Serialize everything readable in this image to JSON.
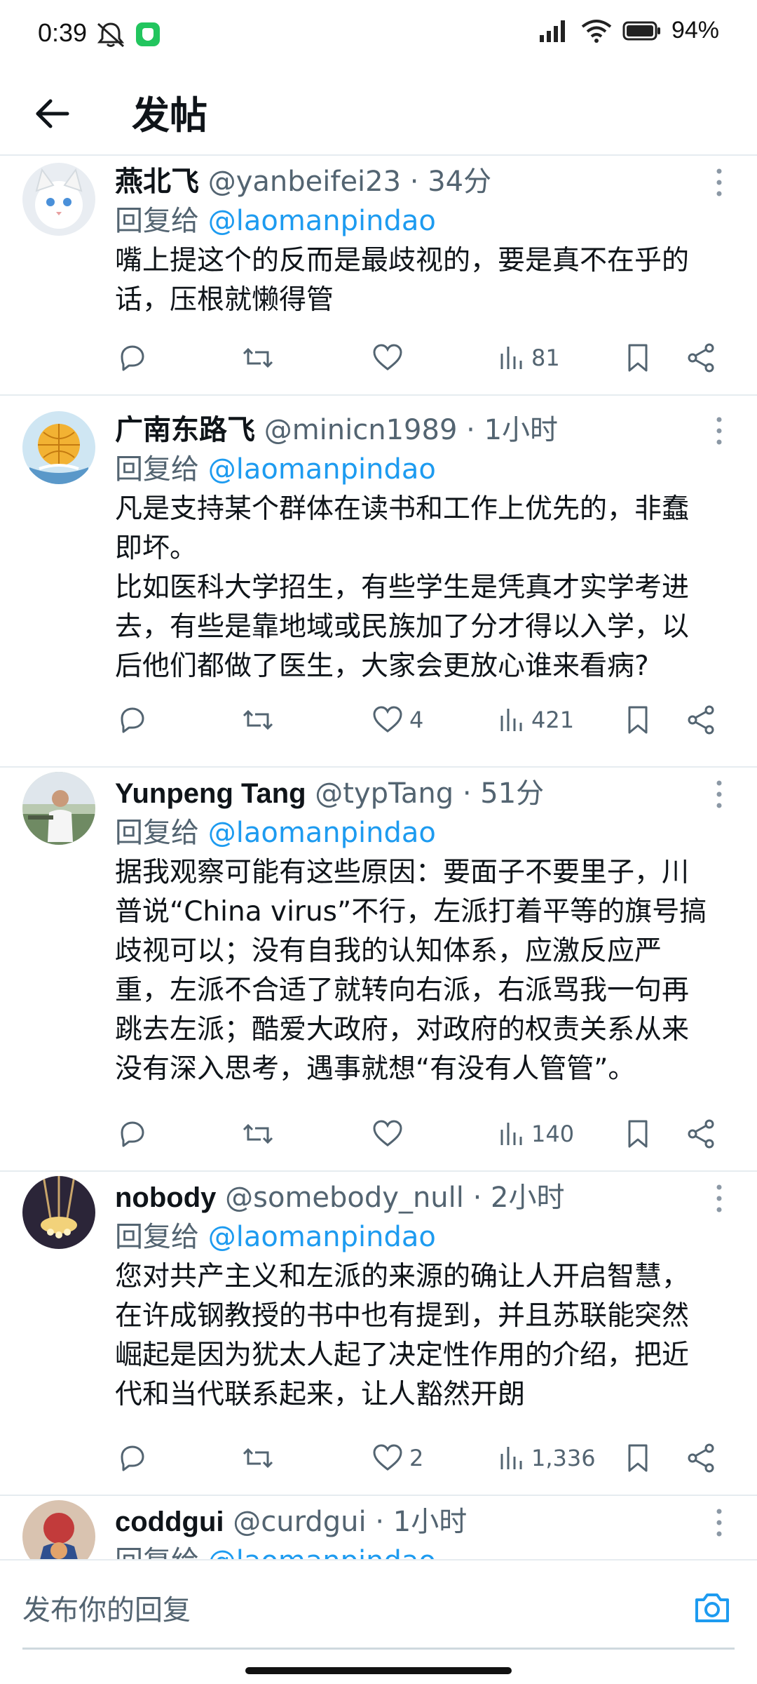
{
  "status_bar": {
    "time": "0:39",
    "battery": "94%"
  },
  "header": {
    "title": "发帖"
  },
  "tweets": [
    {
      "name": "燕北飞",
      "handle": "@yanbeifei23",
      "time": "34分",
      "reply_prefix": "回复给",
      "reply_to": "@laomanpindao",
      "text": "嘴上提这个的反而是最歧视的，要是真不在乎的\n话，压根就懒得管",
      "likes": "",
      "views": "81"
    },
    {
      "name": "广南东路飞",
      "handle": "@minicn1989",
      "time": "1小时",
      "reply_prefix": "回复给",
      "reply_to": "@laomanpindao",
      "text": "凡是支持某个群体在读书和工作上优先的，非蠢\n即坏。\n比如医科大学招生，有些学生是凭真才实学考进\n去，有些是靠地域或民族加了分才得以入学，以\n后他们都做了医生，大家会更放心谁来看病?",
      "likes": "4",
      "views": "421"
    },
    {
      "name": "Yunpeng Tang",
      "handle": "@typTang",
      "time": "51分",
      "reply_prefix": "回复给",
      "reply_to": "@laomanpindao",
      "text": "据我观察可能有这些原因：要面子不要里子，川\n普说“China virus”不行，左派打着平等的旗号搞\n歧视可以；没有自我的认知体系，应激反应严\n重，左派不合适了就转向右派，右派骂我一句再\n跳去左派；酷爱大政府，对政府的权责关系从来\n没有深入思考，遇事就想“有没有人管管”。",
      "likes": "",
      "views": "140"
    },
    {
      "name": "nobody",
      "handle": "@somebody_null",
      "time": "2小时",
      "reply_prefix": "回复给",
      "reply_to": "@laomanpindao",
      "text": "您对共产主义和左派的来源的确让人开启智慧，\n在许成钢教授的书中也有提到，并且苏联能突然\n崛起是因为犹太人起了决定性作用的介绍，把近\n代和当代联系起来，让人豁然开朗",
      "likes": "2",
      "views": "1,336"
    },
    {
      "name": "coddgui",
      "handle": "@curdgui",
      "time": "1小时",
      "reply_prefix": "回复给",
      "reply_to": "@laomanpindao",
      "text": "",
      "likes": "",
      "views": ""
    }
  ],
  "reply_bar": {
    "placeholder": "发布你的回复"
  },
  "icons": {
    "back": "arrow-left-icon",
    "more": "more-vertical-icon",
    "reply": "comment-icon",
    "retweet": "retweet-icon",
    "like": "heart-icon",
    "views": "bar-chart-icon",
    "bookmark": "bookmark-icon",
    "share": "share-icon",
    "camera": "camera-icon"
  },
  "colors": {
    "accent": "#1d9bf0",
    "secondary_text": "#536471",
    "divider": "#e6ecf0"
  }
}
